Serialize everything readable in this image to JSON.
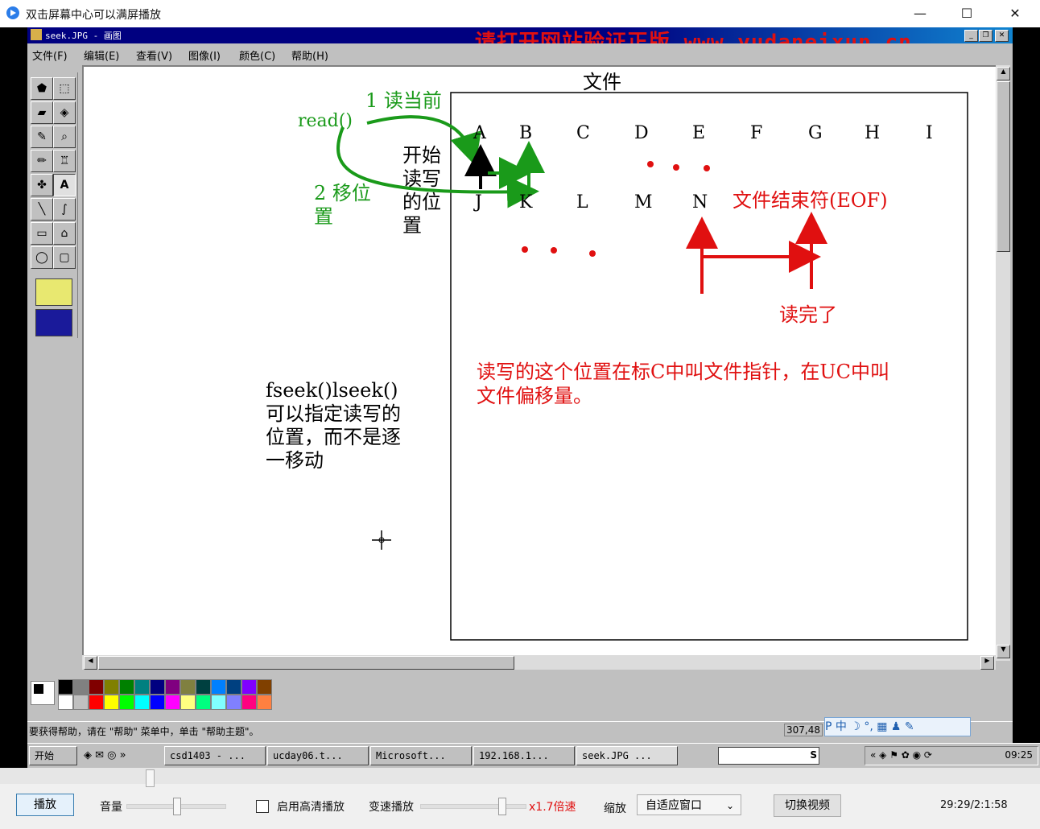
{
  "player": {
    "title": "双击屏幕中心可以满屏播放",
    "minimize": "—",
    "maximize": "☐",
    "close": "✕"
  },
  "paint": {
    "title": "seek.JPG - 画图",
    "watermark": "请打开网站验证正版 www.yudaneixun.cn",
    "menu": [
      "文件(F)",
      "编辑(E)",
      "查看(V)",
      "图像(I)",
      "颜色(C)",
      "帮助(H)"
    ],
    "status": "要获得帮助，请在 \"帮助\" 菜单中，单击 \"帮助主题\"。",
    "coords": "307,48",
    "ime": "P 中 ☽ °, ▦ ♟ ✎",
    "taskbar": {
      "start": "开始",
      "items": [
        "csd1403 - ...",
        "ucday06.t...",
        "Microsoft...",
        "192.168.1...",
        "seek.JPG ..."
      ],
      "search_label": "S",
      "clock": "09:25"
    },
    "palette": [
      "#000000",
      "#808080",
      "#800000",
      "#808000",
      "#008000",
      "#008080",
      "#000080",
      "#800080",
      "#808040",
      "#004040",
      "#0080ff",
      "#004080",
      "#8000ff",
      "#804000",
      "#ffffff",
      "#c0c0c0",
      "#ff0000",
      "#ffff00",
      "#00ff00",
      "#00ffff",
      "#0000ff",
      "#ff00ff",
      "#ffff80",
      "#00ff80",
      "#80ffff",
      "#8080ff",
      "#ff0080",
      "#ff8040"
    ]
  },
  "drawing": {
    "file_label": "文件",
    "row1": [
      "A",
      "B",
      "C",
      "D",
      "E",
      "F",
      "G",
      "H",
      "I"
    ],
    "row2": [
      "J",
      "K",
      "L",
      "M",
      "N"
    ],
    "read_label": "read()",
    "step1_label": "1 读当前",
    "step2_label_line1": "2 移位",
    "step2_label_line2": "置",
    "start_pos_lines": [
      "开始",
      "读写",
      "的位",
      "置"
    ],
    "eof_label": "文件结束符(EOF)",
    "read_done_label": "读完了",
    "explain_line1": "读写的这个位置在标C中叫文件指针，在UC中叫",
    "explain_line2": "文件偏移量。",
    "fseek_lines": [
      "fseek()lseek()",
      "可以指定读写的",
      "位置，而不是逐",
      "一移动"
    ]
  },
  "controls": {
    "play": "播放",
    "volume": "音量",
    "hd": "启用高清播放",
    "speed_label": "变速播放",
    "speed_value": "x1.7倍速",
    "zoom_label": "缩放",
    "zoom_value": "自适应窗口",
    "switch": "切换视频",
    "time": "29:29/2:1:58",
    "progress": 0.14,
    "volume_level": 0.5,
    "speed_level": 0.7
  }
}
